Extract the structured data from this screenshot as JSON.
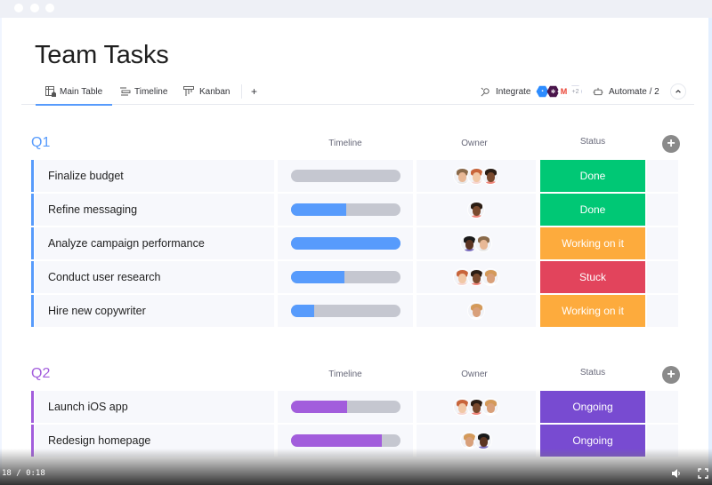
{
  "window": {
    "dots": 3
  },
  "page": {
    "title": "Team Tasks"
  },
  "tabs": [
    {
      "label": "Main Table",
      "icon": "table-home-icon",
      "active": true
    },
    {
      "label": "Timeline",
      "icon": "timeline-icon",
      "active": false
    },
    {
      "label": "Kanban",
      "icon": "kanban-icon",
      "active": false
    }
  ],
  "tab_add_label": "+",
  "toolbar": {
    "integrate_label": "Integrate",
    "integrate_apps": [
      {
        "name": "zoom",
        "color": "#2d8cff"
      },
      {
        "name": "slack",
        "color": "#4a154b"
      },
      {
        "name": "gmail",
        "color": "#ea4335"
      }
    ],
    "integrate_more": "+2",
    "automate_label": "Automate / 2",
    "collapse_icon": "chevron-up-icon"
  },
  "columns": {
    "timeline": "Timeline",
    "owner": "Owner",
    "status": "Status"
  },
  "status_colors": {
    "Done": "#00c875",
    "Working on it": "#fdab3d",
    "Stuck": "#e2445c",
    "Ongoing": "#784bd1"
  },
  "groups": [
    {
      "title": "Q1",
      "color": "#579bfc",
      "rows": [
        {
          "name": "Finalize budget",
          "timeline_progress": 0,
          "owners": 3,
          "status": "Done"
        },
        {
          "name": "Refine messaging",
          "timeline_progress": 0.5,
          "owners": 1,
          "status": "Done"
        },
        {
          "name": "Analyze campaign performance",
          "timeline_progress": 1.0,
          "owners": 2,
          "status": "Working on it"
        },
        {
          "name": "Conduct user research",
          "timeline_progress": 0.49,
          "owners": 3,
          "status": "Stuck"
        },
        {
          "name": "Hire new copywriter",
          "timeline_progress": 0.21,
          "owners": 1,
          "status": "Working on it"
        }
      ]
    },
    {
      "title": "Q2",
      "color": "#a25ddc",
      "rows": [
        {
          "name": "Launch iOS app",
          "timeline_progress": 0.51,
          "owners": 3,
          "status": "Ongoing"
        },
        {
          "name": "Redesign homepage",
          "timeline_progress": 0.83,
          "owners": 2,
          "status": "Ongoing"
        }
      ]
    }
  ],
  "video": {
    "time": "18 / 0:18",
    "volume_icon": "volume-icon",
    "fullscreen_icon": "fullscreen-icon"
  }
}
